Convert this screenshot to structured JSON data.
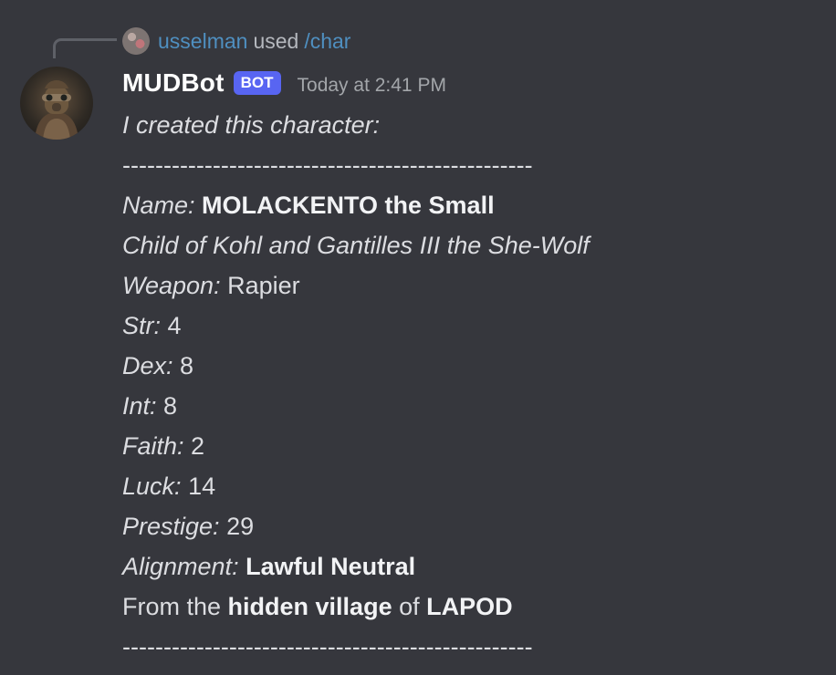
{
  "reply": {
    "username": "usselman",
    "used_text": "used",
    "command": "/char"
  },
  "message": {
    "author": "MUDBot",
    "badge": "BOT",
    "timestamp": "Today at 2:41 PM",
    "intro": "I created this character:",
    "divider": "--------------------------------------------------",
    "name_label": "Name:",
    "name_value": "MOLACKENTO the Small",
    "parentage": "Child of Kohl and Gantilles III the She-Wolf",
    "weapon_label": "Weapon:",
    "weapon_value": "Rapier",
    "stats": [
      {
        "label": "Str:",
        "value": "4"
      },
      {
        "label": "Dex:",
        "value": "8"
      },
      {
        "label": "Int:",
        "value": "8"
      },
      {
        "label": "Faith:",
        "value": "2"
      },
      {
        "label": "Luck:",
        "value": "14"
      },
      {
        "label": "Prestige:",
        "value": "29"
      }
    ],
    "alignment_label": "Alignment:",
    "alignment_value": "Lawful Neutral",
    "origin": {
      "prefix": "From the",
      "place_type": "hidden village",
      "of": "of",
      "place_name": "LAPOD"
    }
  },
  "colors": {
    "background": "#36373d",
    "badge": "#5865f2",
    "link": "#4f8fc0"
  },
  "icons": {
    "reply_avatar": "user-avatar-icon",
    "bot_avatar": "bot-avatar-icon"
  }
}
